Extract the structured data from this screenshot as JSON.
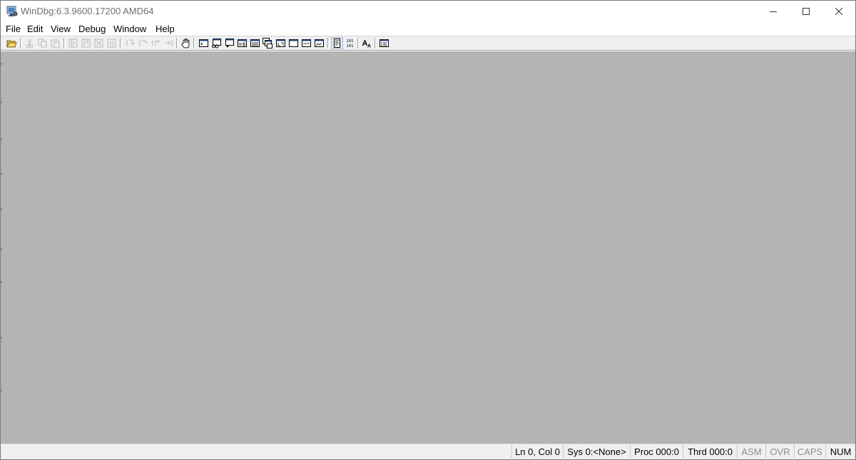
{
  "window": {
    "title": "WinDbg:6.3.9600.17200 AMD64",
    "app_icon": "windbg-icon"
  },
  "caption_buttons": {
    "minimize": "minimize-icon",
    "maximize": "maximize-icon",
    "close": "close-icon"
  },
  "menu": {
    "items": [
      "File",
      "Edit",
      "View",
      "Debug",
      "Window",
      "Help"
    ]
  },
  "toolbar": {
    "buttons": [
      {
        "name": "open-icon",
        "enabled": true
      },
      {
        "name": "cut-icon",
        "enabled": false
      },
      {
        "name": "copy-icon",
        "enabled": false
      },
      {
        "name": "paste-icon",
        "enabled": false
      },
      {
        "name": "go-icon",
        "enabled": false
      },
      {
        "name": "restart-icon",
        "enabled": false
      },
      {
        "name": "stop-debugging-icon",
        "enabled": false
      },
      {
        "name": "break-icon",
        "enabled": false
      },
      {
        "name": "step-into-icon",
        "enabled": false
      },
      {
        "name": "step-over-icon",
        "enabled": false
      },
      {
        "name": "step-out-icon",
        "enabled": false
      },
      {
        "name": "run-to-cursor-icon",
        "enabled": false
      },
      {
        "name": "insert-breakpoint-icon",
        "enabled": true
      },
      {
        "name": "command-window-icon",
        "enabled": true
      },
      {
        "name": "watch-window-icon",
        "enabled": true
      },
      {
        "name": "locals-window-icon",
        "enabled": true
      },
      {
        "name": "registers-window-icon",
        "enabled": true
      },
      {
        "name": "memory-window-icon",
        "enabled": true
      },
      {
        "name": "call-stack-window-icon",
        "enabled": true
      },
      {
        "name": "disassembly-window-icon",
        "enabled": true
      },
      {
        "name": "scratch-pad-icon",
        "enabled": true
      },
      {
        "name": "processes-threads-icon",
        "enabled": true
      },
      {
        "name": "source-mode-icon",
        "enabled": true,
        "pressed": true
      },
      {
        "name": "hex-mode-icon",
        "enabled": true
      },
      {
        "name": "font-icon",
        "enabled": true
      },
      {
        "name": "options-icon",
        "enabled": true
      }
    ],
    "hex_glyph_top": "101",
    "hex_glyph_bottom": "101",
    "font_glyph": "A"
  },
  "statusbar": {
    "position": "Ln 0, Col 0",
    "system": "Sys 0:<None>",
    "process": "Proc 000:0",
    "thread": "Thrd 000:0",
    "asm": "ASM",
    "ovr": "OVR",
    "caps": "CAPS",
    "num": "NUM"
  },
  "colors": {
    "client_background": "#b4b4b4",
    "toolbar_background": "#f0f0f0",
    "title_text": "#6f6f6f"
  }
}
